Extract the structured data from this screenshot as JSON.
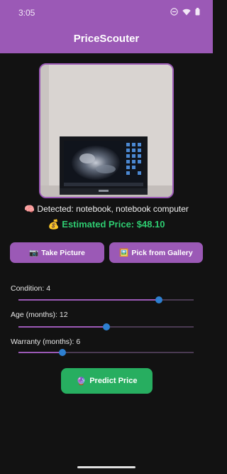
{
  "status_bar": {
    "time": "3:05",
    "icons": [
      "do-not-disturb-icon",
      "wifi-icon",
      "battery-icon"
    ]
  },
  "app": {
    "title": "PriceScouter"
  },
  "photo": {
    "subject": "laptop-photo"
  },
  "detection": {
    "text": "🧠 Detected: notebook, notebook computer"
  },
  "estimate": {
    "text": "💰 Estimated Price: $48.10"
  },
  "buttons": {
    "take_picture": {
      "icon": "📷",
      "label": "Take Picture"
    },
    "pick_gallery": {
      "icon": "🖼️",
      "label": "Pick from Gallery"
    },
    "predict": {
      "icon": "🔮",
      "label": "Predict Price"
    }
  },
  "sliders": [
    {
      "label": "Condition: 4",
      "value": 4,
      "min": 0,
      "max": 5
    },
    {
      "label": "Age (months): 12",
      "value": 12,
      "min": 0,
      "max": 24
    },
    {
      "label": "Warranty (months): 6",
      "value": 6,
      "min": 0,
      "max": 24
    }
  ],
  "colors": {
    "accent": "#9b59b6",
    "success": "#2ecc71",
    "predict_button": "#27ae60",
    "slider_thumb": "#2d7fd0",
    "background": "#121212"
  }
}
